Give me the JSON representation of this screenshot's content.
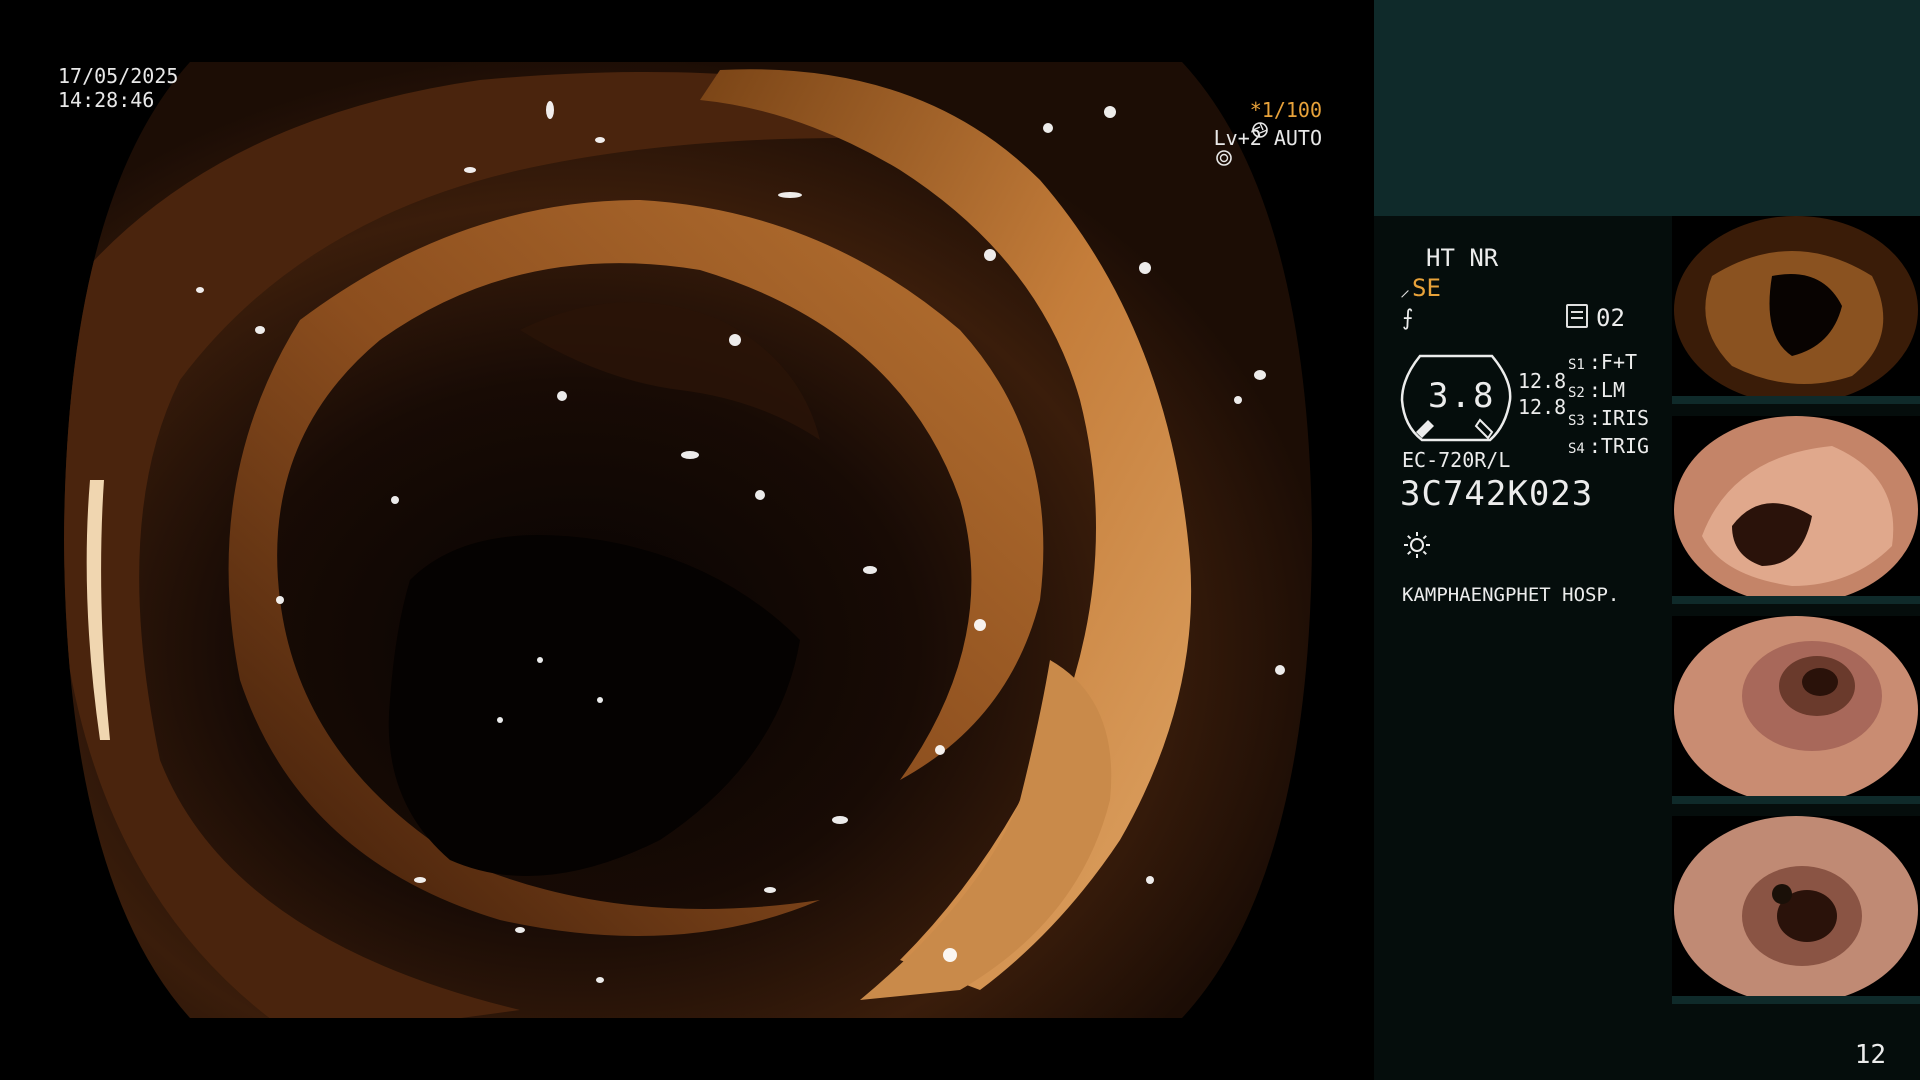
{
  "overlay": {
    "date": "17/05/2025",
    "time": "14:28:46",
    "shutter_prefix": "*",
    "shutter": "1/100",
    "level": "Lv+2",
    "mode": "AUTO"
  },
  "panel": {
    "modes": "HT NR",
    "se_label": "SE",
    "stage_count": "02",
    "gauge_value": "3.8",
    "gauge_nums": [
      "12.8",
      "12.8"
    ],
    "switches": [
      {
        "key": "S1",
        "value": "F+T"
      },
      {
        "key": "S2",
        "value": "LM"
      },
      {
        "key": "S3",
        "value": "IRIS"
      },
      {
        "key": "S4",
        "value": "TRIG"
      }
    ],
    "scope_model": "EC-720R/L",
    "scope_serial": "3C742K023",
    "hospital": "KAMPHAENGPHET HOSP."
  },
  "page_number": "12",
  "colors": {
    "accent": "#e8a23a",
    "panel_top": "#0f2a2a",
    "panel_bg": "#050d0c"
  },
  "icons": {
    "shutter": "aperture-icon",
    "mode": "iris-icon",
    "light": "sun-icon",
    "stage": "list-box-icon"
  }
}
